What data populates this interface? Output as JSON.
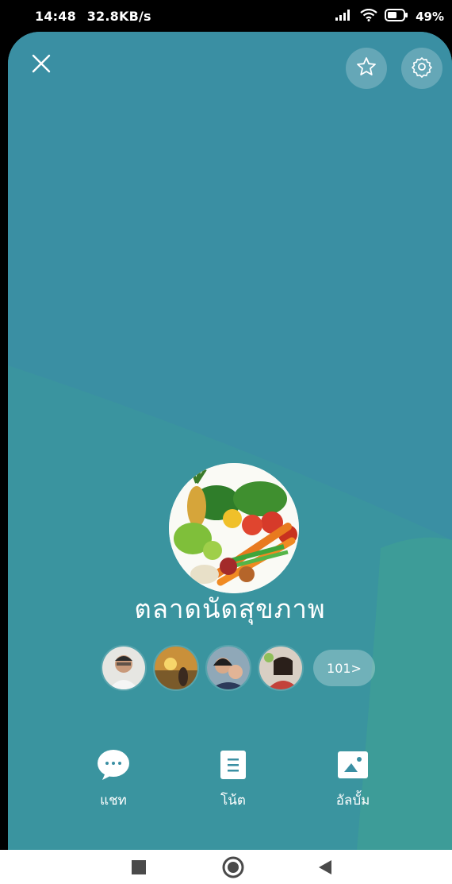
{
  "status": {
    "time": "14:48",
    "speed": "32.8KB/s",
    "battery": "49%",
    "icons": [
      "signal-icon",
      "wifi-icon",
      "battery-icon"
    ]
  },
  "header": {
    "close_icon": "close-icon",
    "favorite_icon": "star-icon",
    "settings_icon": "gear-icon"
  },
  "group": {
    "name": "ตลาดนัดสุขภาพ",
    "member_count": "101>"
  },
  "actions": [
    {
      "label": "แชท",
      "icon": "chat-icon"
    },
    {
      "label": "โน้ต",
      "icon": "note-icon"
    },
    {
      "label": "อัลบั้ม",
      "icon": "album-icon"
    }
  ],
  "colors": {
    "sheet_primary": "#3a8fa3",
    "sheet_secondary": "#3f9a9f",
    "accent_white": "#ffffff"
  }
}
